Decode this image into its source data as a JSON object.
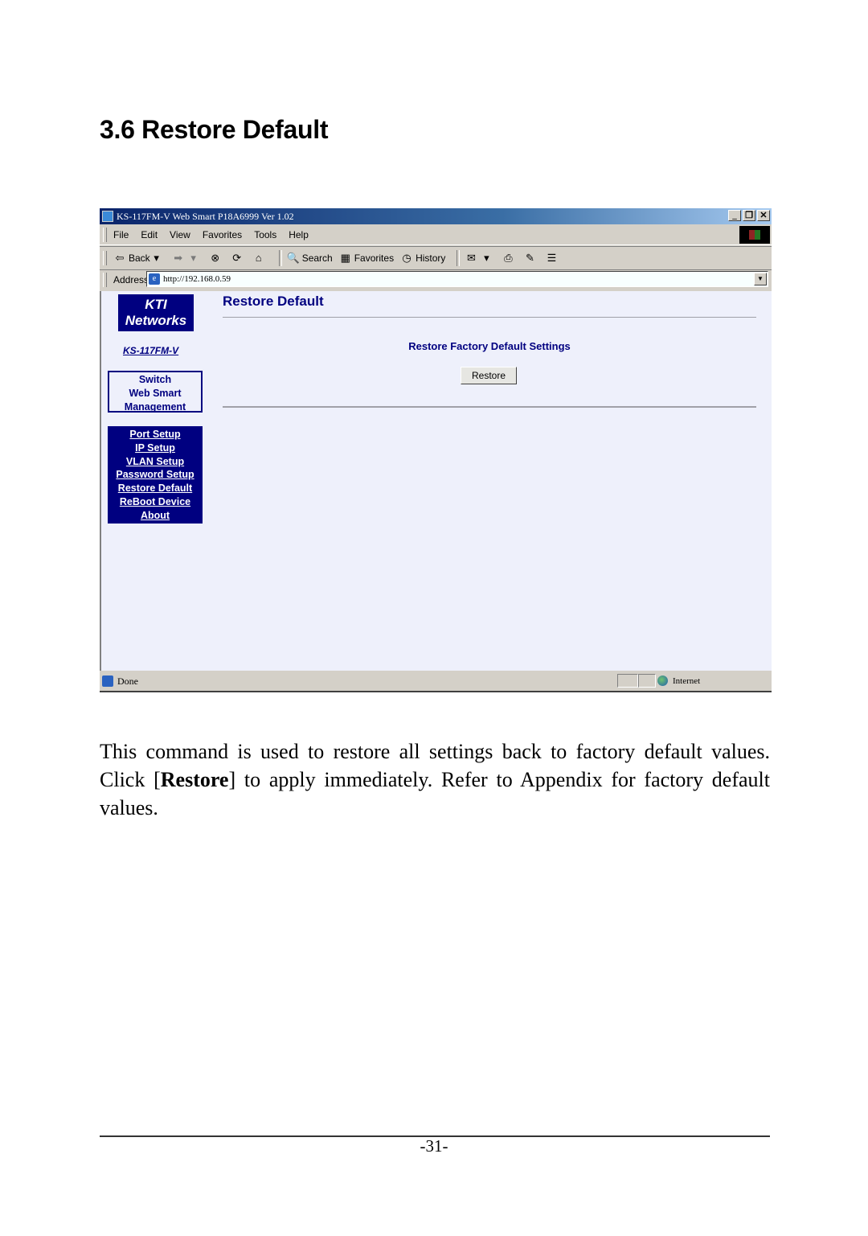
{
  "document": {
    "section_title": "3.6 Restore Default",
    "paragraph": {
      "before": "This command is used to restore all settings back to factory default values. Click [",
      "bold": "Restore",
      "after": "] to apply immediately. Refer to Appendix for factory default values."
    },
    "page_number": "-31-"
  },
  "browser": {
    "title": "KS-117FM-V Web Smart P18A6999 Ver 1.02",
    "window_controls": {
      "minimize": "_",
      "restore": "❐",
      "close": "✕"
    },
    "menu": [
      "File",
      "Edit",
      "View",
      "Favorites",
      "Tools",
      "Help"
    ],
    "toolbar": {
      "back": "Back",
      "back_icon": "⇦",
      "forward_icon": "➡",
      "stop_icon": "⊗",
      "refresh_icon": "⟳",
      "home_icon": "⌂",
      "search": "Search",
      "favorites": "Favorites",
      "history": "History",
      "mail_icon": "✉",
      "print_icon": "⎙",
      "edit_icon": "✎",
      "discuss_icon": "☰",
      "dropdown_arrow": "▾"
    },
    "address": {
      "label": "Address",
      "url": "http://192.168.0.59",
      "dropdown": "▼"
    },
    "status": {
      "text": "Done",
      "zone": "Internet"
    }
  },
  "web_page": {
    "logo": {
      "line1": "KTI",
      "line2": "Networks"
    },
    "model": "KS-117FM-V",
    "brand_box": [
      "Switch",
      "Web Smart",
      "Management"
    ],
    "nav": [
      "Port Setup",
      "IP Setup",
      "VLAN Setup",
      "Password Setup",
      "Restore Default",
      "ReBoot Device",
      "About"
    ],
    "title": "Restore Default",
    "subheading": "Restore Factory Default Settings",
    "restore_button": "Restore"
  }
}
